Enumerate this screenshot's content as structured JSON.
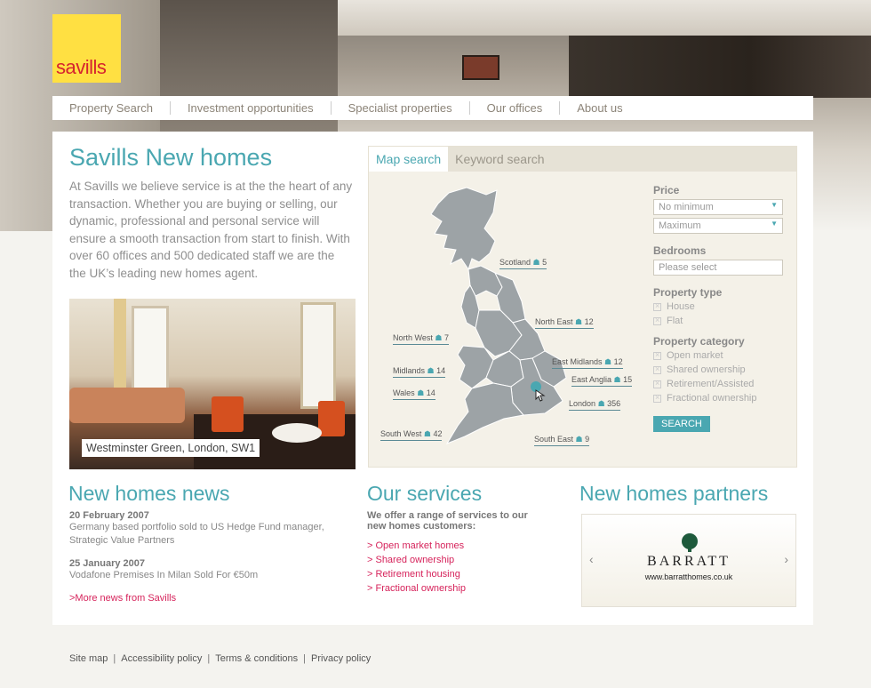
{
  "brand": {
    "logo_text": "savills",
    "logo_color": "#ffe042",
    "logo_text_color": "#d6232f"
  },
  "nav": [
    "Property Search",
    "Investment opportunities",
    "Specialist properties",
    "Our offices",
    "About us"
  ],
  "intro": {
    "title": "Savills New homes",
    "text": "At Savills we believe service is at the the heart of any transaction. Whether you are buying or selling, our dynamic, professional and personal service will ensure a smooth transaction from start to finish. With over 60 offices and 500 dedicated staff we are the the UK’s leading new homes agent."
  },
  "photo_caption": "Westminster Green, London, SW1",
  "search": {
    "tabs": [
      "Map search",
      "Keyword search"
    ],
    "regions": [
      {
        "name": "Scotland",
        "count": "5"
      },
      {
        "name": "North East",
        "count": "12"
      },
      {
        "name": "North West",
        "count": "7"
      },
      {
        "name": "East Midlands",
        "count": "12"
      },
      {
        "name": "Midlands",
        "count": "14"
      },
      {
        "name": "East Anglia",
        "count": "15"
      },
      {
        "name": "Wales",
        "count": "14"
      },
      {
        "name": "London",
        "count": "356"
      },
      {
        "name": "South West",
        "count": "42"
      },
      {
        "name": "South East",
        "count": "9"
      }
    ],
    "price_label": "Price",
    "price_min": "No minimum",
    "price_max": "Maximum",
    "bedrooms_label": "Bedrooms",
    "bedrooms_placeholder": "Please select",
    "type_label": "Property type",
    "types": [
      "House",
      "Flat"
    ],
    "category_label": "Property category",
    "categories": [
      "Open market",
      "Shared ownership",
      "Retirement/Assisted",
      "Fractional ownership"
    ],
    "button": "SEARCH"
  },
  "news": {
    "title": "New homes news",
    "items": [
      {
        "date": "20 February 2007",
        "text": "Germany based portfolio sold to US Hedge Fund manager, Strategic Value Partners"
      },
      {
        "date": "25 January 2007",
        "text": "Vodafone Premises In Milan Sold For €50m"
      }
    ],
    "more": ">More news from Savills"
  },
  "services": {
    "title": "Our services",
    "intro": "We offer a range of services to our new homes customers:",
    "links": [
      "> Open market homes",
      "> Shared ownership",
      "> Retirement housing",
      "> Fractional ownership"
    ]
  },
  "partners": {
    "title": "New homes partners",
    "prev": "‹",
    "next": "›",
    "name": "BARRATT",
    "url": "www.barratthomes.co.uk"
  },
  "footer": [
    "Site map",
    "Accessibility policy",
    "Terms & conditions",
    "Privacy policy"
  ],
  "colors": {
    "accent": "#4aa7b1",
    "link": "#d6235b"
  }
}
